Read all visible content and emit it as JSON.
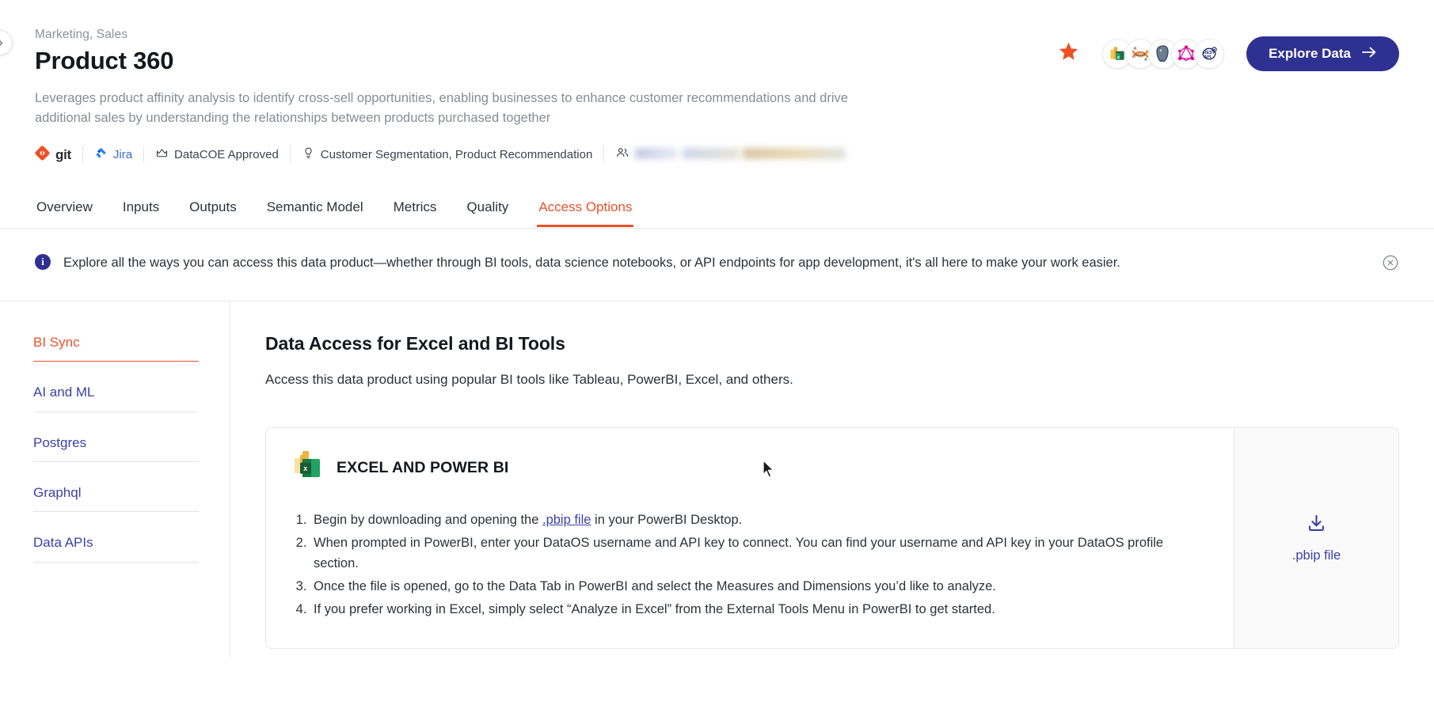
{
  "header": {
    "eyebrow": "Marketing, Sales",
    "title": "Product 360",
    "description": "Leverages product affinity analysis to identify cross-sell opportunities, enabling businesses to enhance customer recommendations and drive additional sales by understanding the relationships between products purchased together",
    "collapse_icon": "chevron-right-icon",
    "favorite_icon": "star-filled-icon",
    "explore_button": "Explore Data",
    "explore_arrow_icon": "arrow-right-icon",
    "accent_star_color": "#f04e23",
    "brand_color": "#2f3192",
    "tool_chips": [
      {
        "name": "powerbi-excel-icon",
        "label": "Excel and Power BI"
      },
      {
        "name": "jupyter-icon",
        "label": "Jupyter"
      },
      {
        "name": "postgres-icon",
        "label": "Postgres"
      },
      {
        "name": "graphql-icon",
        "label": "GraphQL"
      },
      {
        "name": "rest-api-icon",
        "label": "REST API"
      }
    ]
  },
  "meta": {
    "items": [
      {
        "icon": "git-icon",
        "label": "git"
      },
      {
        "icon": "jira-icon",
        "label": "Jira"
      },
      {
        "icon": "crown-icon",
        "label": "DataCOE Approved"
      },
      {
        "icon": "bulb-icon",
        "label": "Customer Segmentation, Product Recommendation"
      },
      {
        "icon": "users-icon",
        "label": "",
        "redacted": true
      }
    ]
  },
  "tabs": [
    {
      "label": "Overview",
      "active": false
    },
    {
      "label": "Inputs",
      "active": false
    },
    {
      "label": "Outputs",
      "active": false
    },
    {
      "label": "Semantic Model",
      "active": false
    },
    {
      "label": "Metrics",
      "active": false
    },
    {
      "label": "Quality",
      "active": false
    },
    {
      "label": "Access Options",
      "active": true
    }
  ],
  "banner": {
    "icon": "info-icon",
    "icon_glyph": "i",
    "text": "Explore all the ways you can access this data product—whether through BI tools, data science notebooks, or API endpoints for app development, it's all here to make your work easier.",
    "close_icon": "close-circle-icon"
  },
  "side_nav": {
    "items": [
      {
        "label": "BI Sync",
        "active": true
      },
      {
        "label": "AI and ML",
        "active": false
      },
      {
        "label": "Postgres",
        "active": false
      },
      {
        "label": "Graphql",
        "active": false
      },
      {
        "label": "Data APIs",
        "active": false
      }
    ]
  },
  "main": {
    "heading": "Data Access for Excel and BI Tools",
    "subheading": "Access this data product using popular BI tools like Tableau, PowerBI, Excel, and others.",
    "card": {
      "icon": "excel-powerbi-icon",
      "title": "EXCEL AND POWER BI",
      "steps": [
        {
          "before": "Begin by downloading and opening the ",
          "link": ".pbip file",
          "after": " in your PowerBI Desktop."
        },
        {
          "before": "When prompted in PowerBI, enter your DataOS username and API key to connect. You can find your username and API key in your DataOS profile section.",
          "link": "",
          "after": ""
        },
        {
          "before": "Once the file is opened, go to the Data Tab in PowerBI and select the Measures and Dimensions you’d like to analyze.",
          "link": "",
          "after": ""
        },
        {
          "before": "If you prefer working in Excel, simply select “Analyze in Excel” from the External Tools Menu in PowerBI to get started.",
          "link": "",
          "after": ""
        }
      ],
      "download": {
        "icon": "download-icon",
        "label": ".pbip file"
      }
    }
  }
}
